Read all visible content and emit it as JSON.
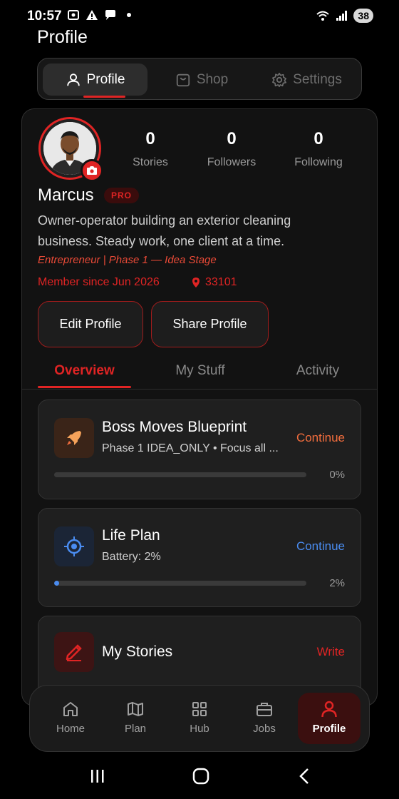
{
  "status": {
    "time": "10:57",
    "battery": "38"
  },
  "page_title": "Profile",
  "top_tabs": [
    {
      "label": "Profile",
      "icon": "person-icon"
    },
    {
      "label": "Shop",
      "icon": "bag-icon"
    },
    {
      "label": "Settings",
      "icon": "gear-icon"
    }
  ],
  "profile": {
    "stats": [
      {
        "value": "0",
        "label": "Stories"
      },
      {
        "value": "0",
        "label": "Followers"
      },
      {
        "value": "0",
        "label": "Following"
      }
    ],
    "name": "Marcus",
    "badge": "PRO",
    "bio": "Owner-operator building an exterior cleaning business. Steady work, one client at a time.",
    "tagline": "Entrepreneur | Phase 1 — Idea Stage",
    "member_since": "Member since Jun 2026",
    "location": "33101",
    "edit_button": "Edit Profile",
    "share_button": "Share Profile"
  },
  "section_tabs": [
    "Overview",
    "My Stuff",
    "Activity"
  ],
  "items": [
    {
      "title": "Boss Moves Blueprint",
      "subtitle": "Phase 1 IDEA_ONLY • Focus all ...",
      "action": "Continue",
      "action_color": "#f26d3d",
      "progress": 0,
      "progress_label": "0%",
      "icon": "rocket-icon"
    },
    {
      "title": "Life Plan",
      "subtitle": "Battery: 2%",
      "action": "Continue",
      "action_color": "#4a8cf0",
      "progress": 2,
      "progress_label": "2%",
      "icon": "target-icon"
    },
    {
      "title": "My Stories",
      "subtitle": "",
      "action": "Write",
      "action_color": "#e02424",
      "icon": "pencil-icon"
    }
  ],
  "bottom_nav": [
    {
      "label": "Home",
      "icon": "home-icon"
    },
    {
      "label": "Plan",
      "icon": "map-icon"
    },
    {
      "label": "Hub",
      "icon": "grid-icon"
    },
    {
      "label": "Jobs",
      "icon": "briefcase-icon"
    },
    {
      "label": "Profile",
      "icon": "person-icon"
    }
  ],
  "colors": {
    "accent": "#e02424",
    "blue": "#4a8cf0",
    "orange": "#f26d3d"
  }
}
